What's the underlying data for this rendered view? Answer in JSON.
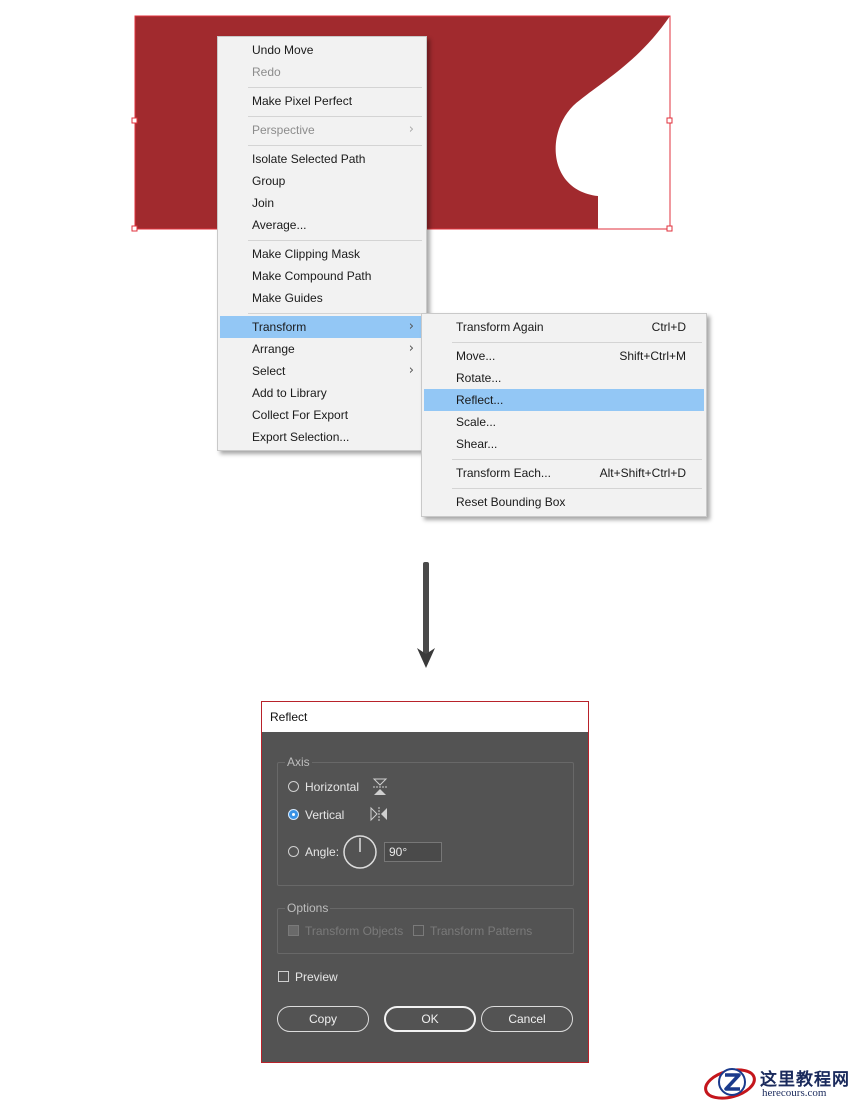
{
  "colors": {
    "shape_fill": "#a12a2e",
    "selection": "#e0323c",
    "menu_bg": "#f2f2f2",
    "highlight": "#93c7f5",
    "dialog_bg": "#535353",
    "dialog_border": "#b8222a",
    "radio_checked": "#3a93e6"
  },
  "context_menu": {
    "undo": "Undo Move",
    "redo": "Redo",
    "pixel_perfect": "Make Pixel Perfect",
    "perspective": "Perspective",
    "isolate": "Isolate Selected Path",
    "group": "Group",
    "join": "Join",
    "average": "Average...",
    "clipping_mask": "Make Clipping Mask",
    "compound_path": "Make Compound Path",
    "guides": "Make Guides",
    "transform": "Transform",
    "arrange": "Arrange",
    "select": "Select",
    "add_library": "Add to Library",
    "collect_export": "Collect For Export",
    "export_selection": "Export Selection...",
    "submenu_arrow": "›"
  },
  "transform_submenu": {
    "again": "Transform Again",
    "again_shortcut": "Ctrl+D",
    "move": "Move...",
    "move_shortcut": "Shift+Ctrl+M",
    "rotate": "Rotate...",
    "reflect": "Reflect...",
    "scale": "Scale...",
    "shear": "Shear...",
    "each": "Transform Each...",
    "each_shortcut": "Alt+Shift+Ctrl+D",
    "reset_bbox": "Reset Bounding Box"
  },
  "dialog": {
    "title": "Reflect",
    "axis_group": "Axis",
    "horizontal": "Horizontal",
    "vertical": "Vertical",
    "angle_label": "Angle:",
    "angle_value": "90°",
    "options_group": "Options",
    "transform_objects": "Transform Objects",
    "transform_patterns": "Transform Patterns",
    "preview": "Preview",
    "copy": "Copy",
    "ok": "OK",
    "cancel": "Cancel"
  },
  "logo": {
    "text": "这里教程网",
    "url": "herecours.com"
  }
}
